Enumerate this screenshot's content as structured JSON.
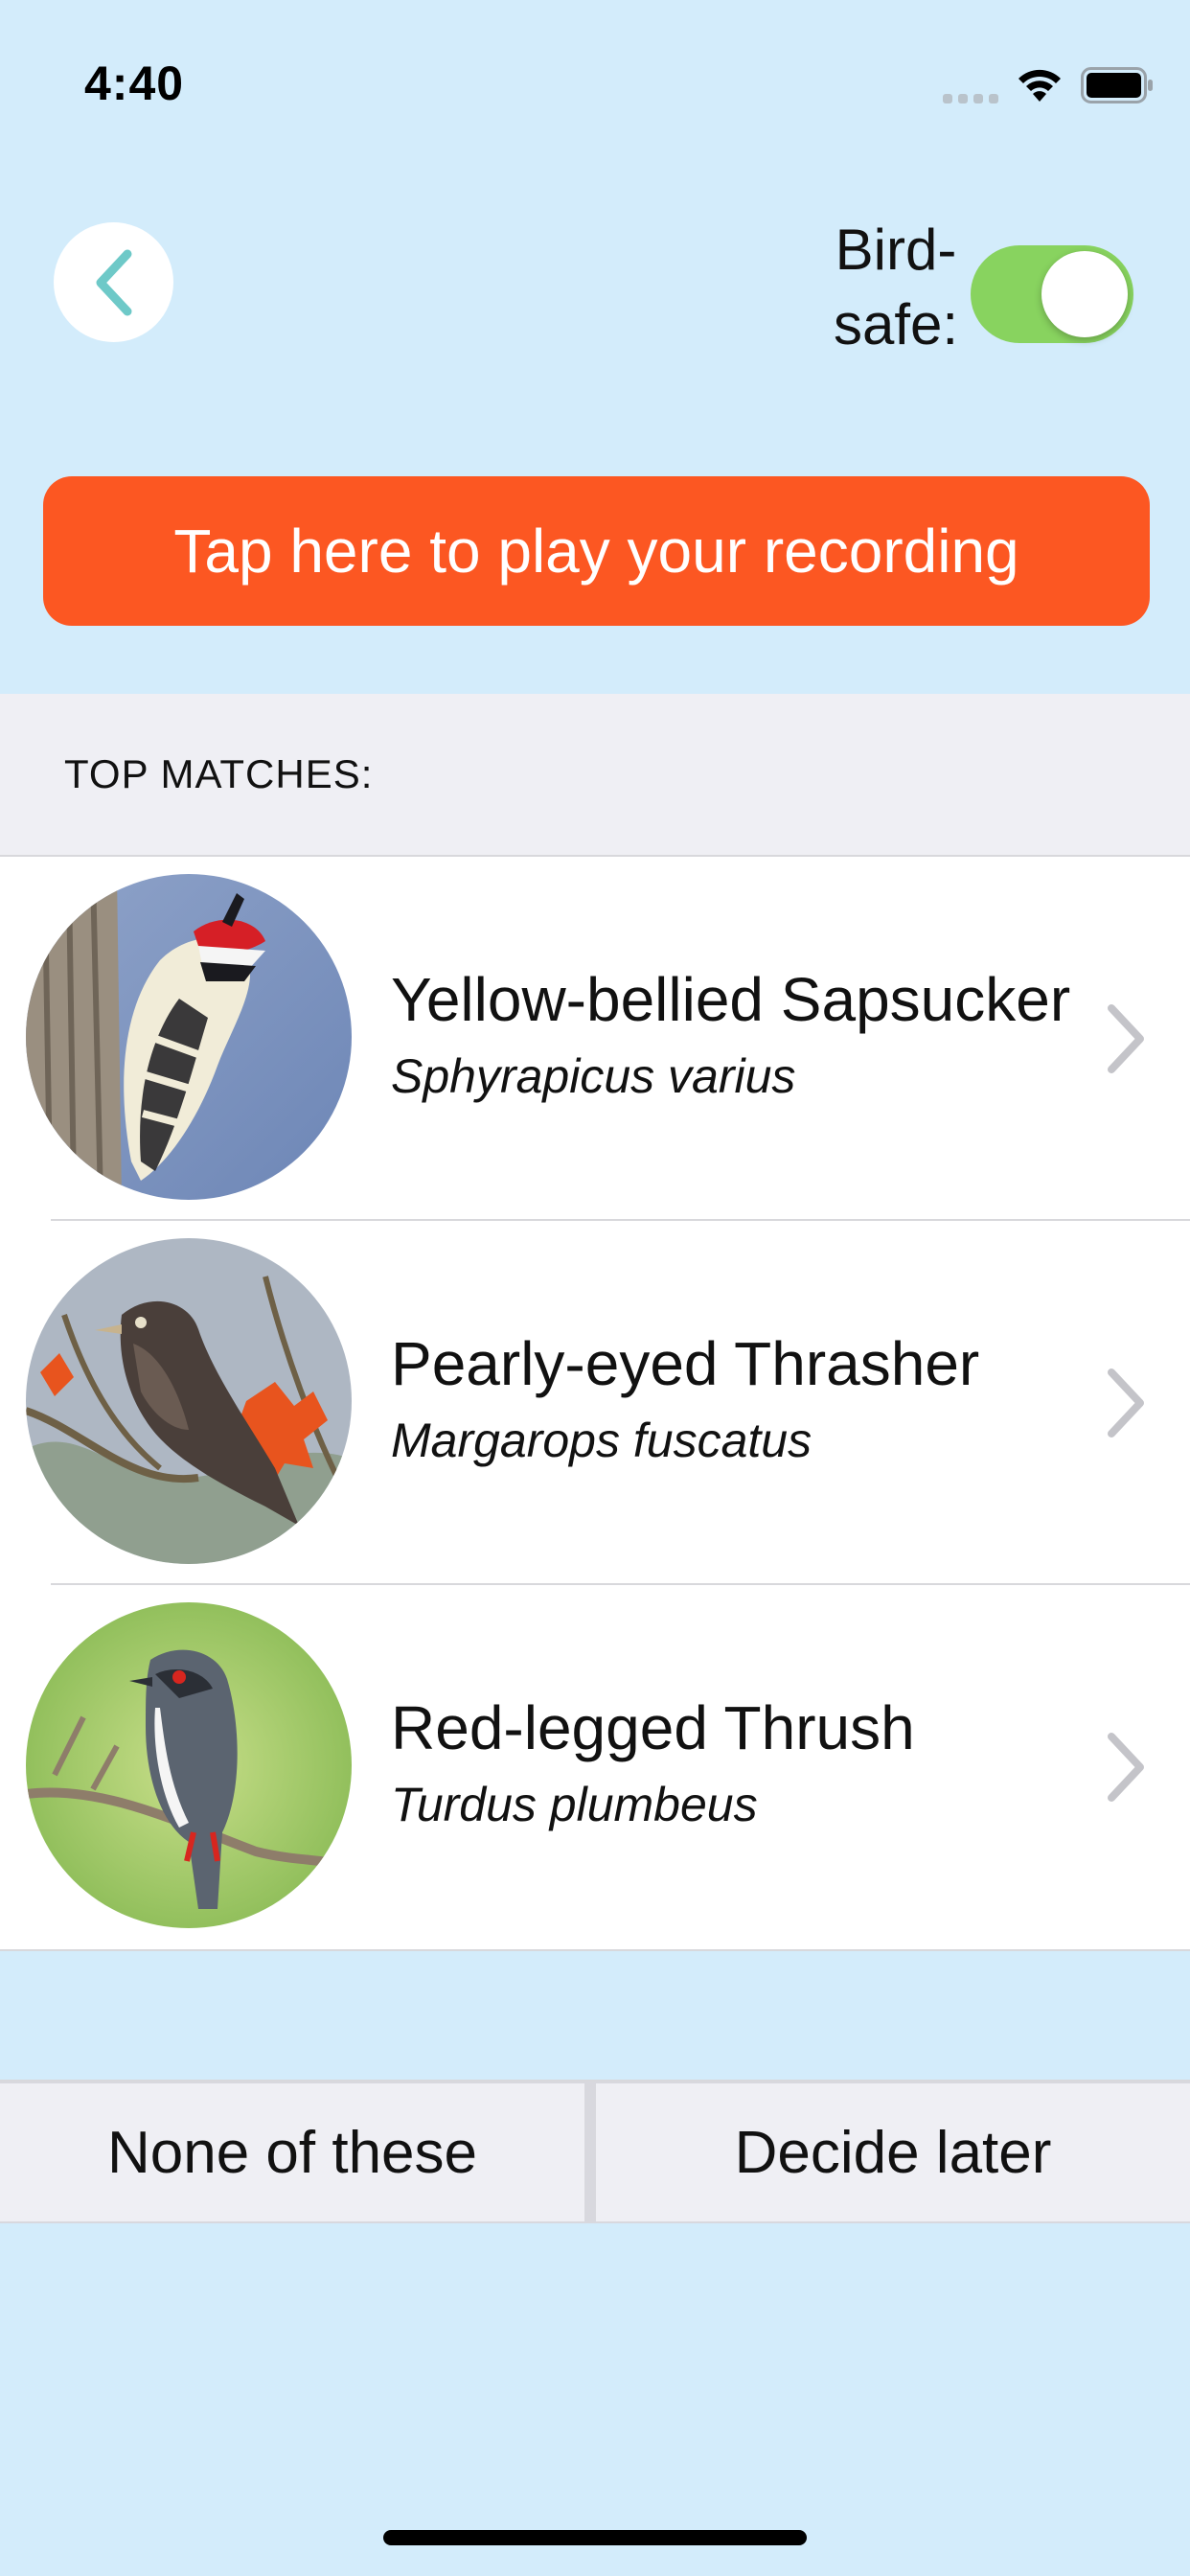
{
  "status_bar": {
    "time": "4:40",
    "icons": [
      "cellular-signal-icon",
      "wifi-icon",
      "battery-icon"
    ]
  },
  "header": {
    "back_icon": "chevron-left-icon",
    "birdsafe_label_line1": "Bird-",
    "birdsafe_label_line2": "safe:",
    "birdsafe_enabled": true
  },
  "play_button": {
    "label": "Tap here to play your recording"
  },
  "matches": {
    "section_title": "TOP MATCHES:",
    "items": [
      {
        "common_name": "Yellow-bellied Sapsucker",
        "scientific_name": "Sphyrapicus varius",
        "image": "sapsucker-photo"
      },
      {
        "common_name": "Pearly-eyed Thrasher",
        "scientific_name": "Margarops fuscatus",
        "image": "thrasher-photo"
      },
      {
        "common_name": "Red-legged Thrush",
        "scientific_name": "Turdus plumbeus",
        "image": "thrush-photo"
      }
    ]
  },
  "actions": {
    "none_label": "None of these",
    "later_label": "Decide later"
  },
  "colors": {
    "background": "#d3ecfb",
    "accent_orange": "#fc5722",
    "toggle_on": "#88d35f",
    "back_chevron": "#6ec9c8",
    "section_gray": "#efeff4"
  }
}
